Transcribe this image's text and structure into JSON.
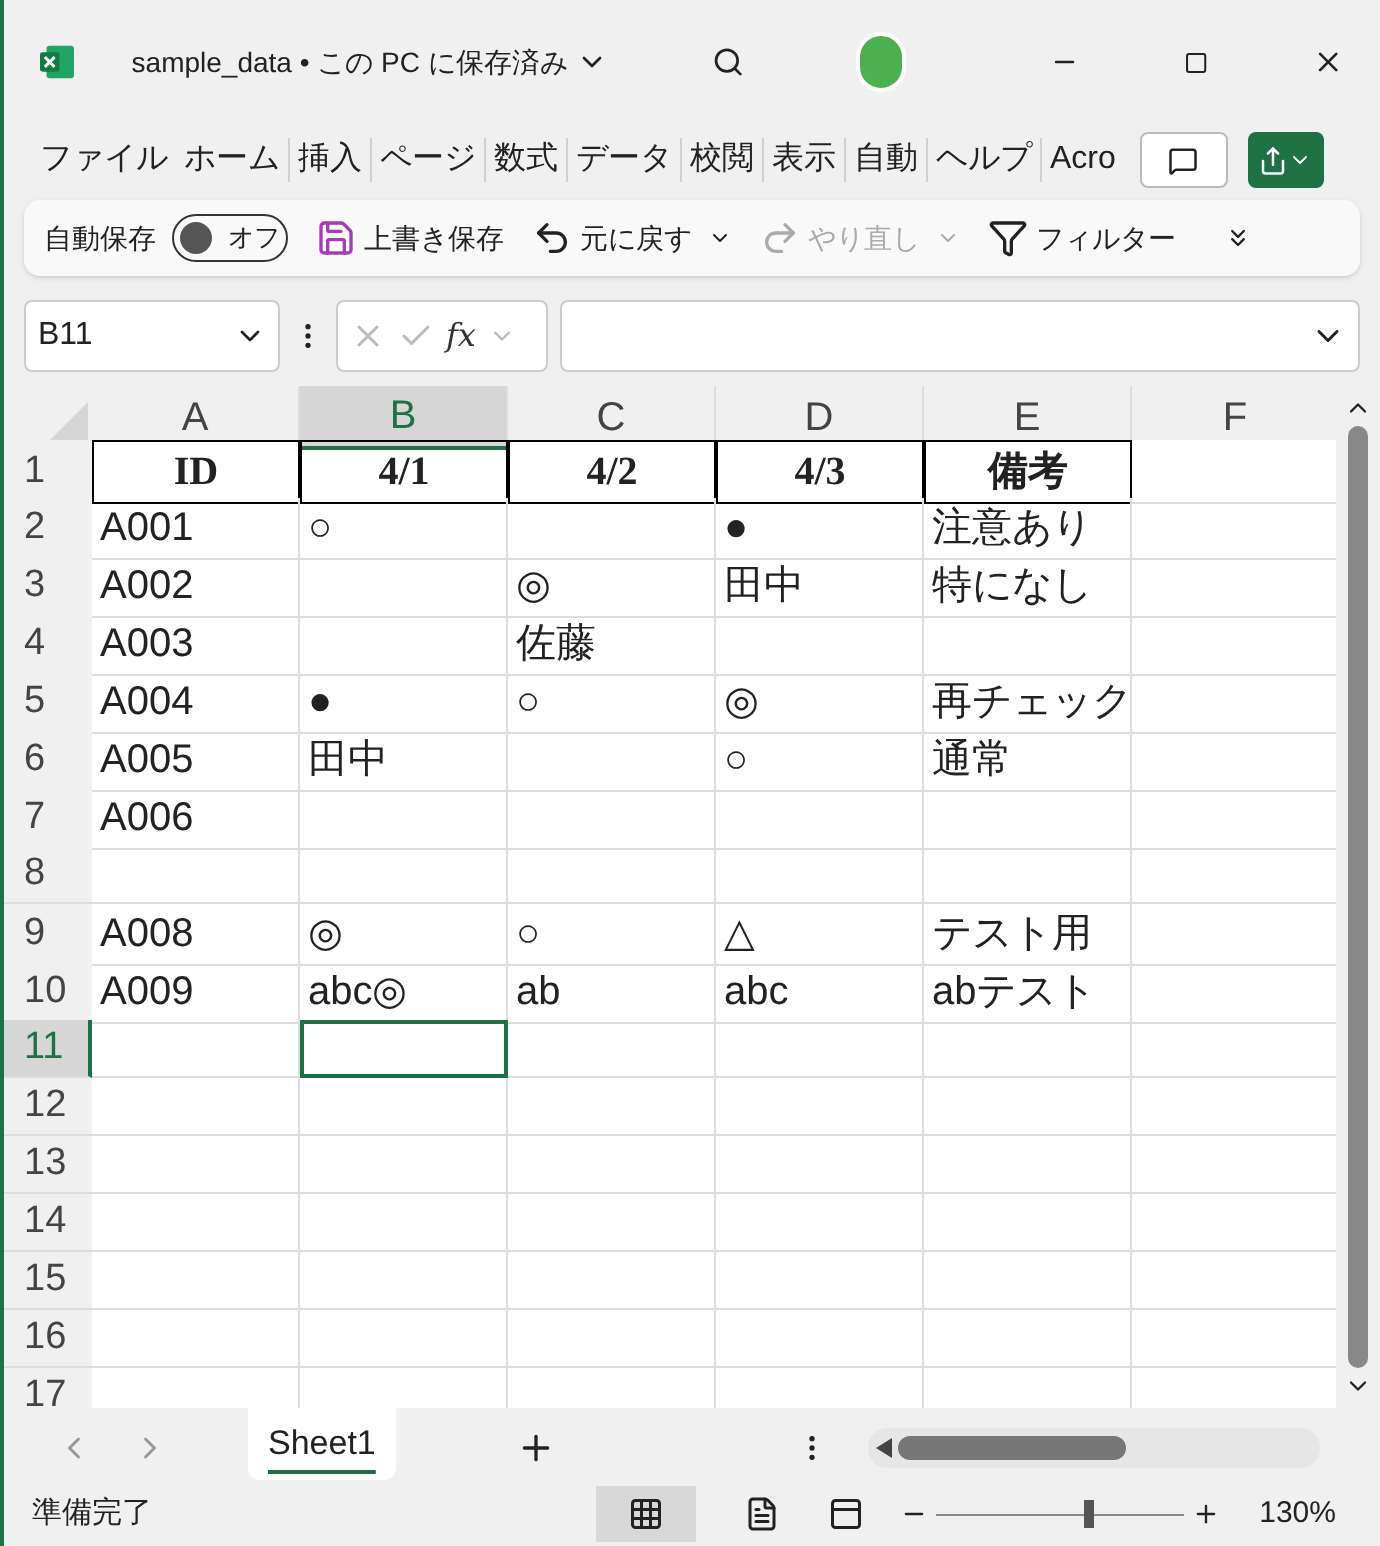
{
  "window": {
    "title": "sample_data • この PC に保存済み"
  },
  "ribbon_tabs": [
    "ファイル",
    "ホーム",
    "挿入",
    "ページ",
    "数式",
    "データ",
    "校閲",
    "表示",
    "自動",
    "ヘルプ",
    "Acro"
  ],
  "quick_toolbar": {
    "autosave_label": "自動保存",
    "autosave": {
      "label": "オフ",
      "on": false
    },
    "items": [
      {
        "kind": "save",
        "label": "上書き保存",
        "disabled": false
      },
      {
        "kind": "undo",
        "label": "元に戻す",
        "disabled": false
      },
      {
        "kind": "redo",
        "label": "やり直し",
        "disabled": true
      },
      {
        "kind": "filter",
        "label": "フィルター",
        "disabled": false
      }
    ]
  },
  "formula_bar": {
    "name_box": "B11",
    "fx": "fx"
  },
  "columns": [
    {
      "label": "A",
      "selected": false
    },
    {
      "label": "B",
      "selected": true
    },
    {
      "label": "C",
      "selected": false
    },
    {
      "label": "D",
      "selected": false
    },
    {
      "label": "E",
      "selected": false
    },
    {
      "label": "F",
      "selected": false
    }
  ],
  "rows": [
    {
      "number": "1",
      "kind": "header",
      "selected": false,
      "cells": [
        "ID",
        "4/1",
        "4/2",
        "4/3",
        "備考",
        null
      ]
    },
    {
      "number": "2",
      "kind": "data",
      "selected": false,
      "cells": [
        "A001",
        "○",
        null,
        "●",
        "注意あり",
        null
      ]
    },
    {
      "number": "3",
      "kind": "data",
      "selected": false,
      "cells": [
        "A002",
        null,
        "◎",
        "田中",
        "特になし",
        null
      ]
    },
    {
      "number": "4",
      "kind": "data",
      "selected": false,
      "cells": [
        "A003",
        null,
        "佐藤",
        null,
        null,
        null
      ]
    },
    {
      "number": "5",
      "kind": "data",
      "selected": false,
      "cells": [
        "A004",
        "●",
        "○",
        "◎",
        "再チェック",
        null
      ]
    },
    {
      "number": "6",
      "kind": "data",
      "selected": false,
      "cells": [
        "A005",
        "田中",
        null,
        "○",
        "通常",
        null
      ]
    },
    {
      "number": "7",
      "kind": "data",
      "selected": false,
      "cells": [
        "A006",
        null,
        null,
        null,
        null,
        null
      ]
    },
    {
      "number": "8",
      "kind": "data",
      "selected": false,
      "cells": [
        null,
        null,
        null,
        null,
        null,
        null
      ]
    },
    {
      "number": "9",
      "kind": "data",
      "selected": false,
      "cells": [
        "A008",
        "◎",
        "○",
        "△",
        "テスト用",
        null
      ]
    },
    {
      "number": "10",
      "kind": "data",
      "selected": false,
      "cells": [
        "A009",
        "abc◎",
        "ab",
        "abc",
        "abテスト",
        null
      ]
    },
    {
      "number": "11",
      "kind": "data",
      "selected": true,
      "cells": [
        null,
        null,
        null,
        null,
        null,
        null
      ]
    },
    {
      "number": "12",
      "kind": "data",
      "selected": false,
      "cells": [
        null,
        null,
        null,
        null,
        null,
        null
      ]
    },
    {
      "number": "13",
      "kind": "data",
      "selected": false,
      "cells": [
        null,
        null,
        null,
        null,
        null,
        null
      ]
    },
    {
      "number": "14",
      "kind": "data",
      "selected": false,
      "cells": [
        null,
        null,
        null,
        null,
        null,
        null
      ]
    },
    {
      "number": "15",
      "kind": "data",
      "selected": false,
      "cells": [
        null,
        null,
        null,
        null,
        null,
        null
      ]
    },
    {
      "number": "16",
      "kind": "data",
      "selected": false,
      "cells": [
        null,
        null,
        null,
        null,
        null,
        null
      ]
    },
    {
      "number": "17",
      "kind": "data",
      "selected": false,
      "cells": [
        null,
        null,
        null,
        null,
        null,
        null
      ]
    }
  ],
  "sheet_tabs": [
    {
      "label": "Sheet1",
      "selected": true
    }
  ],
  "status_bar": {
    "status": "準備完了",
    "zoom": {
      "level": 0.6
    },
    "zoom_reading": "130%"
  }
}
